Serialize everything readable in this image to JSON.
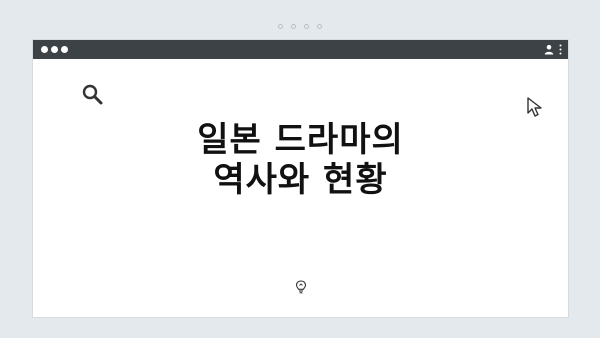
{
  "title": {
    "line1": "일본 드라마의",
    "line2": "역사와 현황"
  },
  "icons": {
    "search": "search-icon",
    "cursor": "cursor-icon",
    "user": "user-icon",
    "menu": "menu-icon",
    "bulb": "lightbulb-icon"
  },
  "colors": {
    "background": "#e4e9ee",
    "titlebar": "#3d4246",
    "window": "#ffffff",
    "text": "#111111"
  }
}
